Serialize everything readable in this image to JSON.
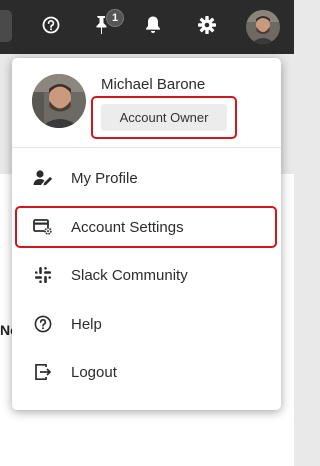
{
  "topbar": {
    "icons": [
      "help-circle-icon",
      "pin-icon",
      "bell-icon",
      "gear-icon",
      "user-avatar"
    ],
    "pin_badge_count": "1"
  },
  "background": {
    "partial_text": "No"
  },
  "profile": {
    "name": "Michael Barone",
    "role": "Account Owner"
  },
  "menu": {
    "items": [
      {
        "label": "My Profile",
        "icon": "user-edit-icon"
      },
      {
        "label": "Account Settings",
        "icon": "settings-card-icon"
      },
      {
        "label": "Slack Community",
        "icon": "slack-icon"
      },
      {
        "label": "Help",
        "icon": "help-circle-icon"
      },
      {
        "label": "Logout",
        "icon": "logout-icon"
      }
    ]
  },
  "colors": {
    "topbar": "#2b2b2b",
    "highlight": "#d0171f",
    "badge_bg": "#ececec"
  }
}
